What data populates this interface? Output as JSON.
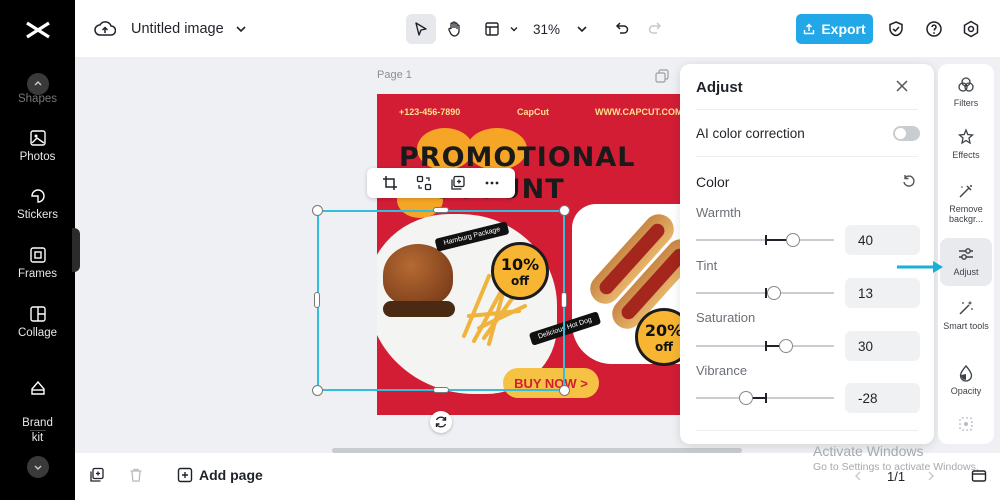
{
  "app": {
    "brand_color": "#000000",
    "accent_color": "#22a7e8",
    "selection_color": "#34bedc"
  },
  "left_sidebar": {
    "items": [
      {
        "label": "Shapes",
        "icon": "shapes-icon"
      },
      {
        "label": "Photos",
        "icon": "photo-icon"
      },
      {
        "label": "Stickers",
        "icon": "sticker-icon"
      },
      {
        "label": "Frames",
        "icon": "frame-icon"
      },
      {
        "label": "Collage",
        "icon": "collage-icon"
      },
      {
        "label": "Brand\nkit",
        "icon": "brand-kit-icon"
      }
    ]
  },
  "topbar": {
    "title": "Untitled image",
    "zoom": "31%",
    "export_label": "Export"
  },
  "canvas": {
    "page_label": "Page 1"
  },
  "poster": {
    "phone": "+123-456-7890",
    "brand": "CapCut",
    "website": "WWW.CAPCUT.COM",
    "headline_1": "PROMOTIONAL",
    "headline_2": "DISCOUNT",
    "tag_1": "Hamburg Package",
    "tag_2": "Delicious Hot Dog",
    "badge_1_value": "10%",
    "badge_1_unit": "off",
    "badge_2_value": "20%",
    "badge_2_unit": "off",
    "cta": "BUY NOW >"
  },
  "bottombar": {
    "add_page_label": "Add page",
    "page_count": "1/1"
  },
  "adjust_panel": {
    "title": "Adjust",
    "ai_label": "AI color correction",
    "ai_enabled": false,
    "color_section": "Color",
    "sliders": [
      {
        "label": "Warmth",
        "value": "40"
      },
      {
        "label": "Tint",
        "value": "13"
      },
      {
        "label": "Saturation",
        "value": "30"
      },
      {
        "label": "Vibrance",
        "value": "-28"
      }
    ]
  },
  "right_rail": {
    "items": [
      {
        "label": "Filters",
        "icon": "filters-icon"
      },
      {
        "label": "Effects",
        "icon": "effects-icon"
      },
      {
        "label": "Remove backgr...",
        "icon": "remove-background-icon"
      },
      {
        "label": "Adjust",
        "icon": "adjust-icon",
        "active": true
      },
      {
        "label": "Smart tools",
        "icon": "smart-tools-icon"
      },
      {
        "label": "Opacity",
        "icon": "opacity-icon"
      }
    ]
  },
  "watermark": {
    "line1": "Activate Windows",
    "line2": "Go to Settings to activate Windows."
  }
}
